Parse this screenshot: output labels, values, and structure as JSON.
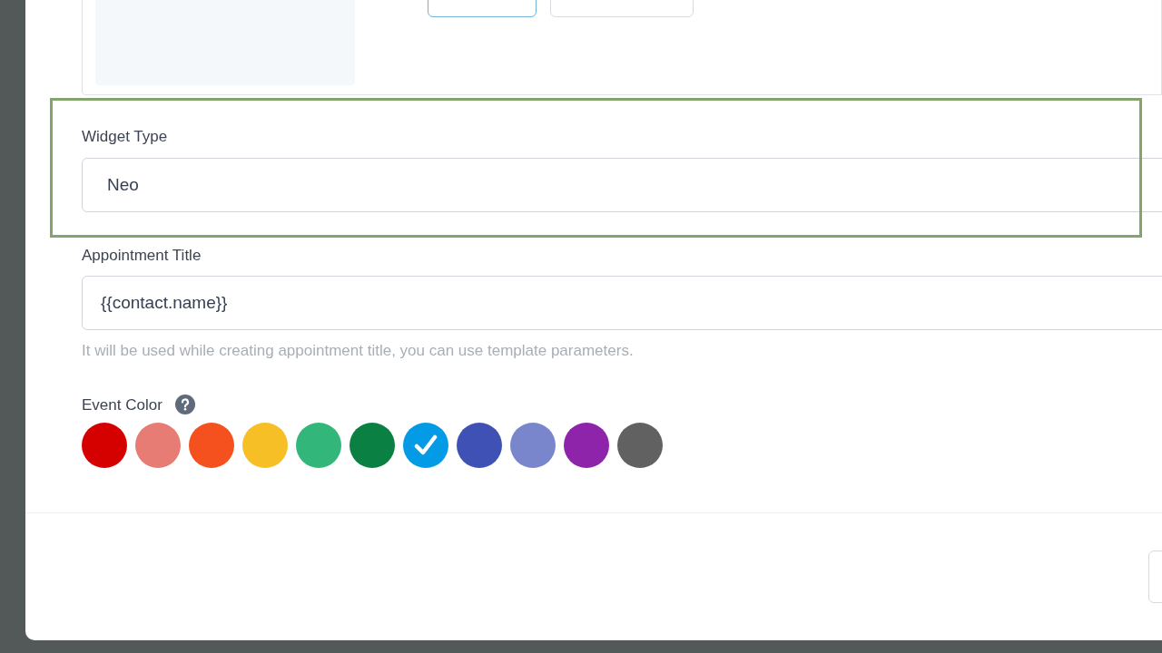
{
  "image_buttons": [
    {
      "kind": "primary"
    },
    {
      "kind": "default"
    }
  ],
  "widget_type": {
    "label": "Widget Type",
    "value": "Neo",
    "highlighted": true
  },
  "appointment_title": {
    "label": "Appointment Title",
    "value": "{{contact.name}}",
    "hint": "It will be used while creating appointment title, you can use template parameters."
  },
  "event_color": {
    "label": "Event Color",
    "colors": [
      {
        "color": "#d50000",
        "selected": false
      },
      {
        "color": "#e67c73",
        "selected": false
      },
      {
        "color": "#f4511e",
        "selected": false
      },
      {
        "color": "#f6bf26",
        "selected": false
      },
      {
        "color": "#33b679",
        "selected": false
      },
      {
        "color": "#0b8043",
        "selected": false
      },
      {
        "color": "#039be5",
        "selected": true
      },
      {
        "color": "#3f51b5",
        "selected": false
      },
      {
        "color": "#7986cb",
        "selected": false
      },
      {
        "color": "#8e24aa",
        "selected": false
      },
      {
        "color": "#616161",
        "selected": false
      }
    ]
  },
  "footer_buttons": [
    {
      "kind": "default"
    }
  ]
}
